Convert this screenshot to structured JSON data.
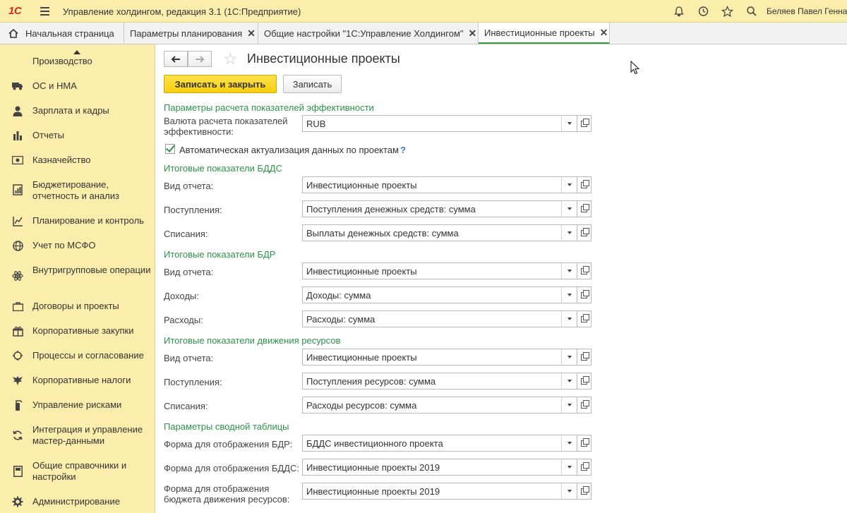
{
  "titlebar": {
    "logo": "1С",
    "title": "Управление холдингом, редакция 3.1  (1С:Предприятие)",
    "user": "Беляев Павел Геннадьевич",
    "icons": [
      "bell-icon",
      "history-icon",
      "star-icon",
      "search-icon"
    ]
  },
  "tabs": [
    {
      "label": "Начальная страница",
      "closable": false
    },
    {
      "label": "Параметры планирования",
      "closable": true
    },
    {
      "label": "Общие настройки \"1С:Управление Холдингом\"",
      "closable": true
    },
    {
      "label": "Инвестиционные проекты",
      "closable": true,
      "active": true
    }
  ],
  "sidebar": {
    "items": [
      {
        "label": "Производство",
        "icon": "factory-icon"
      },
      {
        "label": "ОС и НМА",
        "icon": "truck-icon"
      },
      {
        "label": "Зарплата и кадры",
        "icon": "person-icon"
      },
      {
        "label": "Отчеты",
        "icon": "bar-chart-icon"
      },
      {
        "label": "Казначейство",
        "icon": "money-icon"
      },
      {
        "label": "Бюджетирование, отчетность и анализ",
        "icon": "budget-icon"
      },
      {
        "label": "Планирование и контроль",
        "icon": "planning-icon"
      },
      {
        "label": "Учет по МСФО",
        "icon": "globe-icon"
      },
      {
        "label": "Внутригрупповые операции",
        "icon": "atom-icon"
      },
      {
        "label": "Договоры и проекты",
        "icon": "briefcase-icon"
      },
      {
        "label": "Корпоративные закупки",
        "icon": "gift-icon"
      },
      {
        "label": "Процессы и согласование",
        "icon": "process-icon"
      },
      {
        "label": "Корпоративные налоги",
        "icon": "eagle-icon"
      },
      {
        "label": "Управление рисками",
        "icon": "fire-extinguisher-icon"
      },
      {
        "label": "Интеграция и управление мастер-данными",
        "icon": "sync-icon"
      },
      {
        "label": "Общие справочники и настройки",
        "icon": "book-icon"
      },
      {
        "label": "Администрирование",
        "icon": "gear-icon"
      }
    ]
  },
  "form": {
    "title": "Инвестиционные проекты",
    "save_close": "Записать и закрыть",
    "save": "Записать",
    "sections": [
      {
        "title": "Параметры расчета показателей эффективности",
        "fields": [
          {
            "label": "Валюта расчета показателей эффективности:",
            "value": "RUB"
          }
        ]
      },
      {
        "title": "Итоговые показатели БДДС",
        "fields": [
          {
            "label": "Вид отчета:",
            "value": "Инвестиционные проекты"
          },
          {
            "label": "Поступления:",
            "value": "Поступления денежных средств: сумма"
          },
          {
            "label": "Списания:",
            "value": "Выплаты денежных средств: сумма"
          }
        ]
      },
      {
        "title": "Итоговые показатели БДР",
        "fields": [
          {
            "label": "Вид отчета:",
            "value": "Инвестиционные проекты"
          },
          {
            "label": "Доходы:",
            "value": "Доходы: сумма"
          },
          {
            "label": "Расходы:",
            "value": "Расходы: сумма"
          }
        ]
      },
      {
        "title": "Итоговые показатели движения ресурсов",
        "fields": [
          {
            "label": "Вид отчета:",
            "value": "Инвестиционные проекты"
          },
          {
            "label": "Поступления:",
            "value": "Поступления ресурсов: сумма"
          },
          {
            "label": "Списания:",
            "value": "Расходы ресурсов: сумма"
          }
        ]
      },
      {
        "title": "Параметры сводной таблицы",
        "fields": [
          {
            "label": "Форма для отображения БДР:",
            "value": "БДДС инвестиционного проекта"
          },
          {
            "label": "Форма для отображения БДДС:",
            "value": "Инвестиционные проекты 2019"
          },
          {
            "label": "Форма для отображения бюджета движения ресурсов:",
            "value": "Инвестиционные проекты 2019"
          }
        ]
      }
    ],
    "auto_update_label": "Автоматическая актуализация данных по проектам",
    "auto_update_checked": true,
    "help_mark": "?"
  },
  "colors": {
    "accent_yellow": "#fbedab",
    "section_green": "#2b9349",
    "primary_button": "#f5cf0d"
  }
}
